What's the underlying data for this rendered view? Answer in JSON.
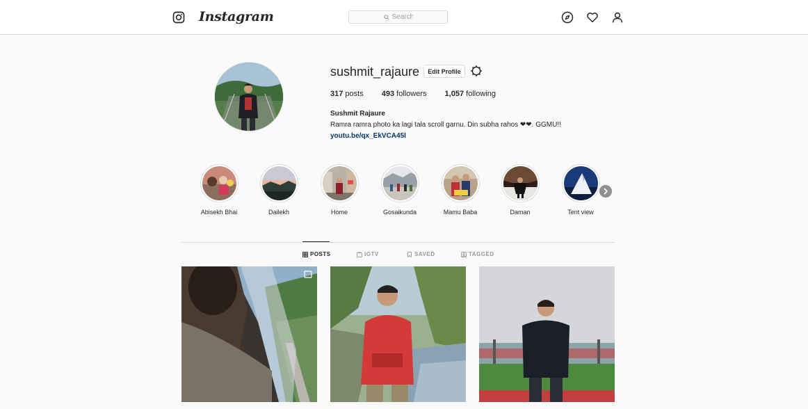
{
  "nav": {
    "brand": "Instagram",
    "search_placeholder": "Search",
    "icons": [
      "instagram-logo-icon",
      "compass-icon",
      "heart-icon",
      "user-icon"
    ]
  },
  "profile": {
    "username": "sushmit_rajaure",
    "edit_label": "Edit Profile",
    "stats": [
      {
        "count": "317",
        "label": "posts"
      },
      {
        "count": "493",
        "label": "followers"
      },
      {
        "count": "1,057",
        "label": "following"
      }
    ],
    "full_name": "Sushmit Rajaure",
    "bio": "Ramra ramra photo ka lagi tala scroll garnu. Din subha rahos ❤❤. GGMU!!",
    "link": "youtu.be/qx_EkVCA45I"
  },
  "highlights": [
    {
      "label": "Abisekh Bhai"
    },
    {
      "label": "Dailekh"
    },
    {
      "label": "Home"
    },
    {
      "label": "Gosaikunda"
    },
    {
      "label": "Mamu Baba"
    },
    {
      "label": "Daman"
    },
    {
      "label": "Tent view"
    }
  ],
  "tabs": [
    {
      "label": "POSTS",
      "active": true
    },
    {
      "label": "IGTV",
      "active": false
    },
    {
      "label": "SAVED",
      "active": false
    },
    {
      "label": "TAGGED",
      "active": false
    }
  ],
  "colors": {
    "link": "#003569",
    "text": "#262626",
    "muted": "#999999",
    "border": "#dbdbdb",
    "background": "#fafafa"
  }
}
